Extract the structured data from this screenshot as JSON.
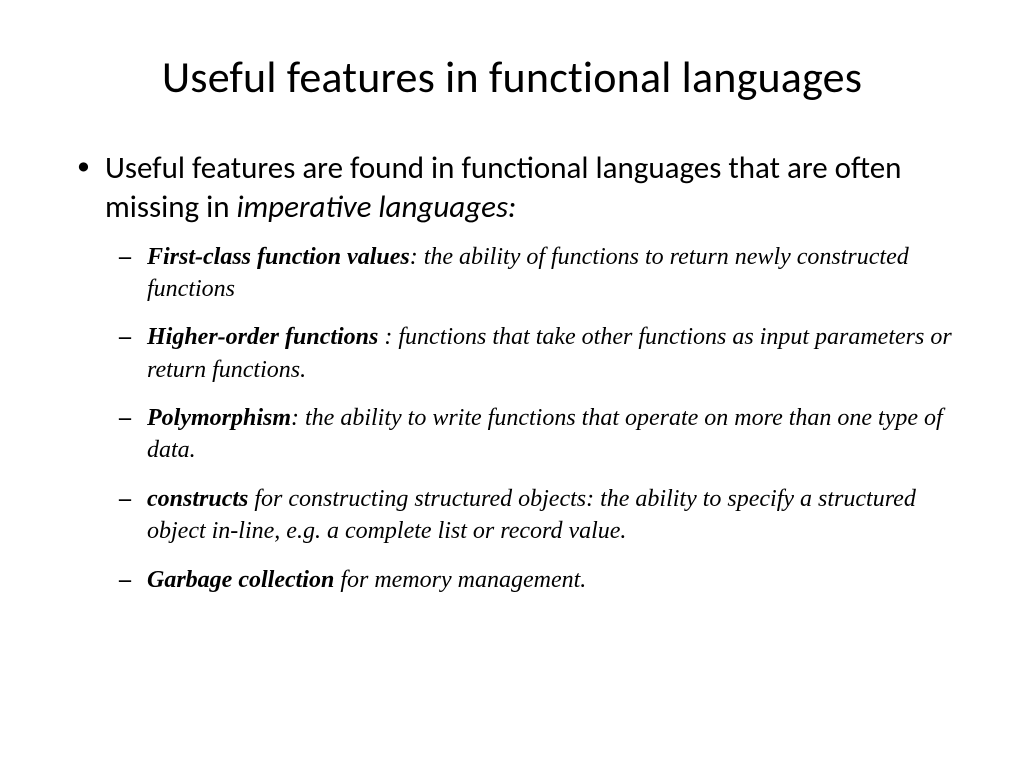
{
  "title": "Useful features in functional languages",
  "main": {
    "text_plain": "Useful features are found in functional languages that are often missing in ",
    "text_italic": "imperative languages:"
  },
  "sub": [
    {
      "term": "First-class function values",
      "rest": ": the ability of functions to return newly constructed functions"
    },
    {
      "term": "Higher-order functions",
      "rest": " : functions that take other functions as input parameters or return functions."
    },
    {
      "term": "Polymorphism",
      "rest": ": the ability to write functions that operate on more than one type of data."
    },
    {
      "term": "constructs",
      "rest": " for constructing structured objects: the ability to specify a structured object in-line, e.g. a complete list or record value."
    },
    {
      "term": "Garbage collection",
      "rest": " for memory management."
    }
  ]
}
